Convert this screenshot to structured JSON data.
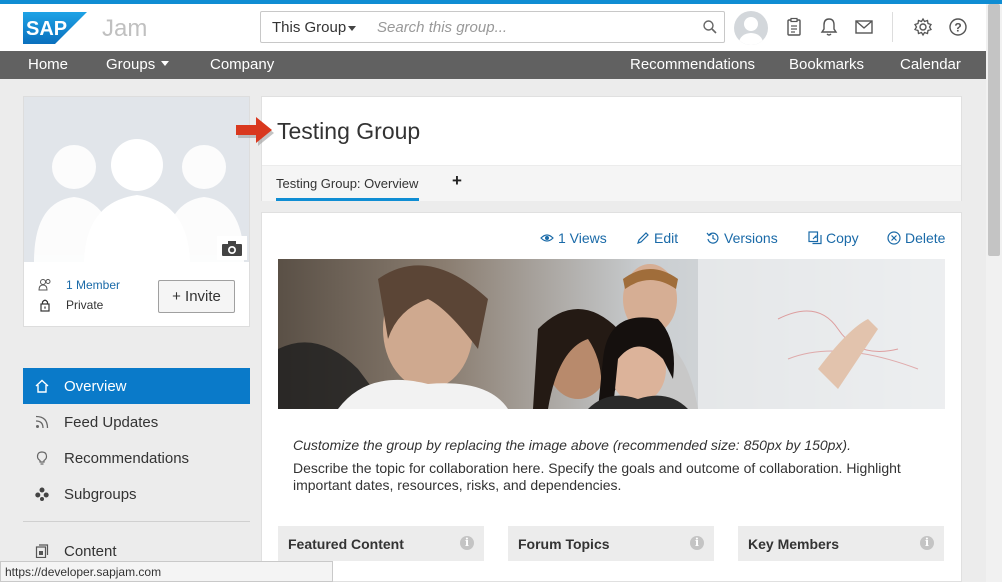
{
  "header": {
    "brand": "SAP",
    "app_name": "Jam",
    "scope_label": "This Group",
    "search_placeholder": "Search this group..."
  },
  "nav": {
    "home": "Home",
    "groups": "Groups",
    "company": "Company",
    "recommendations": "Recommendations",
    "bookmarks": "Bookmarks",
    "calendar": "Calendar"
  },
  "profile": {
    "members": "1 Member",
    "privacy": "Private",
    "invite_label": "+ Invite"
  },
  "sidebar": {
    "items": [
      {
        "label": "Overview",
        "icon": "home-icon",
        "active": true
      },
      {
        "label": "Feed Updates",
        "icon": "feed-icon",
        "active": false
      },
      {
        "label": "Recommendations",
        "icon": "lightbulb-icon",
        "active": false
      },
      {
        "label": "Subgroups",
        "icon": "subgroups-icon",
        "active": false
      },
      {
        "label": "Content",
        "icon": "content-icon",
        "active": false
      }
    ]
  },
  "group": {
    "title": "Testing Group",
    "tab_label": "Testing Group: Overview",
    "add_tab": "+"
  },
  "actions": {
    "views": "1 Views",
    "edit": "Edit",
    "versions": "Versions",
    "copy": "Copy",
    "delete": "Delete"
  },
  "content": {
    "hint": "Customize the group by replacing the image above (recommended size: 850px by 150px).",
    "description": "Describe the topic for collaboration here. Specify the goals and outcome of collaboration. Highlight important dates, resources, risks, and dependencies."
  },
  "widgets": [
    {
      "title": "Featured Content"
    },
    {
      "title": "Forum Topics"
    },
    {
      "title": "Key Members"
    }
  ],
  "statusbar": {
    "url": "https://developer.sapjam.com"
  },
  "colors": {
    "accent": "#0f8dd3",
    "active_nav": "#0a7ac9",
    "nav_bar": "#616161",
    "link": "#1a6aa8",
    "arrow": "#d9381e"
  }
}
